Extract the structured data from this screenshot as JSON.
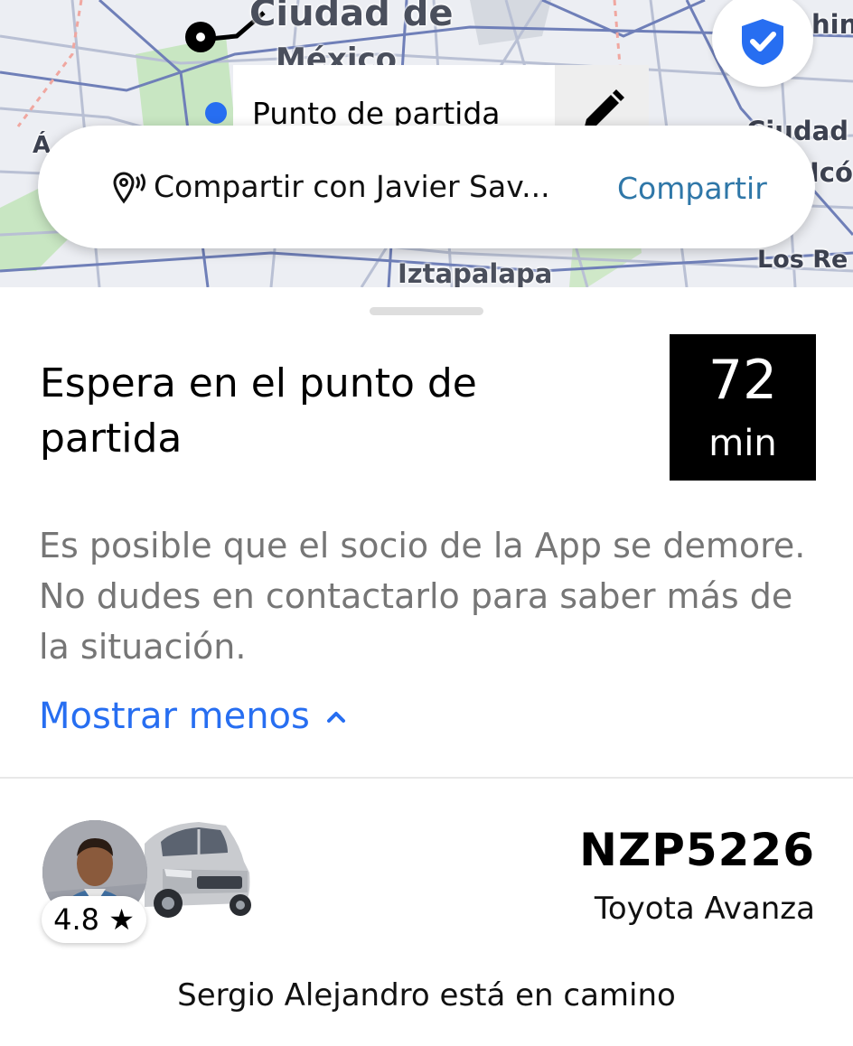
{
  "map": {
    "labels": {
      "city_line1": "Ciudad de",
      "city_line2": "México",
      "iztapalapa": "Iztapalapa",
      "los_re": "Los Re",
      "ciudad_right": "Ciudad",
      "hin": "hin",
      "ico": "Icó",
      "left_fragment": "Á"
    },
    "pickup_label": "Punto de partida",
    "route_color": "#000000",
    "pickup_color": "#276ef1"
  },
  "share": {
    "text": "Compartir con Javier Sav...",
    "action": "Compartir",
    "action_color": "#2f77a8"
  },
  "trip": {
    "title": "Espera en el punto de partida",
    "eta_value": "72",
    "eta_unit": "min",
    "description": "Es posible que el socio de la App se demore. No dudes en contactarlo para saber más de la situación.",
    "toggle_label": "Mostrar menos",
    "link_color": "#276ef1"
  },
  "driver": {
    "rating": "4.8 ★",
    "plate": "NZP5226",
    "car_model": "Toyota Avanza",
    "status": "Sergio Alejandro está en camino"
  }
}
